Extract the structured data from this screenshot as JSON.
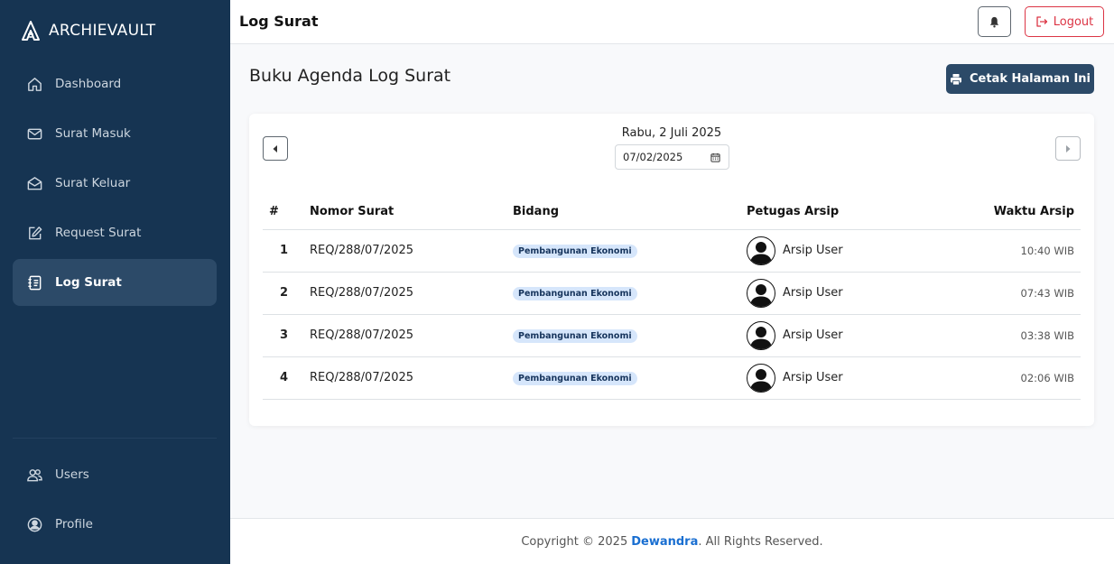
{
  "brand": {
    "name": "ARCHIEVAULT"
  },
  "sidebar": {
    "items": [
      {
        "label": "Dashboard",
        "icon": "home-icon"
      },
      {
        "label": "Surat Masuk",
        "icon": "envelope-icon"
      },
      {
        "label": "Surat Keluar",
        "icon": "envelope-open-icon"
      },
      {
        "label": "Request Surat",
        "icon": "edit-icon"
      },
      {
        "label": "Log Surat",
        "icon": "journal-icon",
        "active": true
      }
    ],
    "bottom_items": [
      {
        "label": "Users",
        "icon": "users-icon"
      },
      {
        "label": "Profile",
        "icon": "profile-icon"
      }
    ]
  },
  "topbar": {
    "title": "Log Surat",
    "logout_label": "Logout"
  },
  "page": {
    "heading": "Buku Agenda Log Surat",
    "print_label": "Cetak Halaman Ini"
  },
  "date_nav": {
    "label": "Rabu, 2 Juli 2025",
    "input_value": "07/02/2025"
  },
  "table": {
    "headers": {
      "no": "#",
      "nomor": "Nomor Surat",
      "bidang": "Bidang",
      "petugas": "Petugas Arsip",
      "waktu": "Waktu Arsip"
    },
    "rows": [
      {
        "no": "1",
        "nomor": "REQ/288/07/2025",
        "bidang": "Pembangunan Ekonomi",
        "petugas": "Arsip User",
        "waktu": "10:40 WIB"
      },
      {
        "no": "2",
        "nomor": "REQ/288/07/2025",
        "bidang": "Pembangunan Ekonomi",
        "petugas": "Arsip User",
        "waktu": "07:43 WIB"
      },
      {
        "no": "3",
        "nomor": "REQ/288/07/2025",
        "bidang": "Pembangunan Ekonomi",
        "petugas": "Arsip User",
        "waktu": "03:38 WIB"
      },
      {
        "no": "4",
        "nomor": "REQ/288/07/2025",
        "bidang": "Pembangunan Ekonomi",
        "petugas": "Arsip User",
        "waktu": "02:06 WIB"
      }
    ]
  },
  "footer": {
    "prefix": "Copyright © 2025",
    "brand": "Dewandra",
    "suffix": ". All Rights Reserved."
  },
  "colors": {
    "sidebar": "#163452",
    "sidebar_active": "#2c4a68",
    "primary_button": "#2c4a68",
    "danger": "#dc3545",
    "link": "#1a6fd1",
    "badge_bg": "#d6e6fb"
  }
}
